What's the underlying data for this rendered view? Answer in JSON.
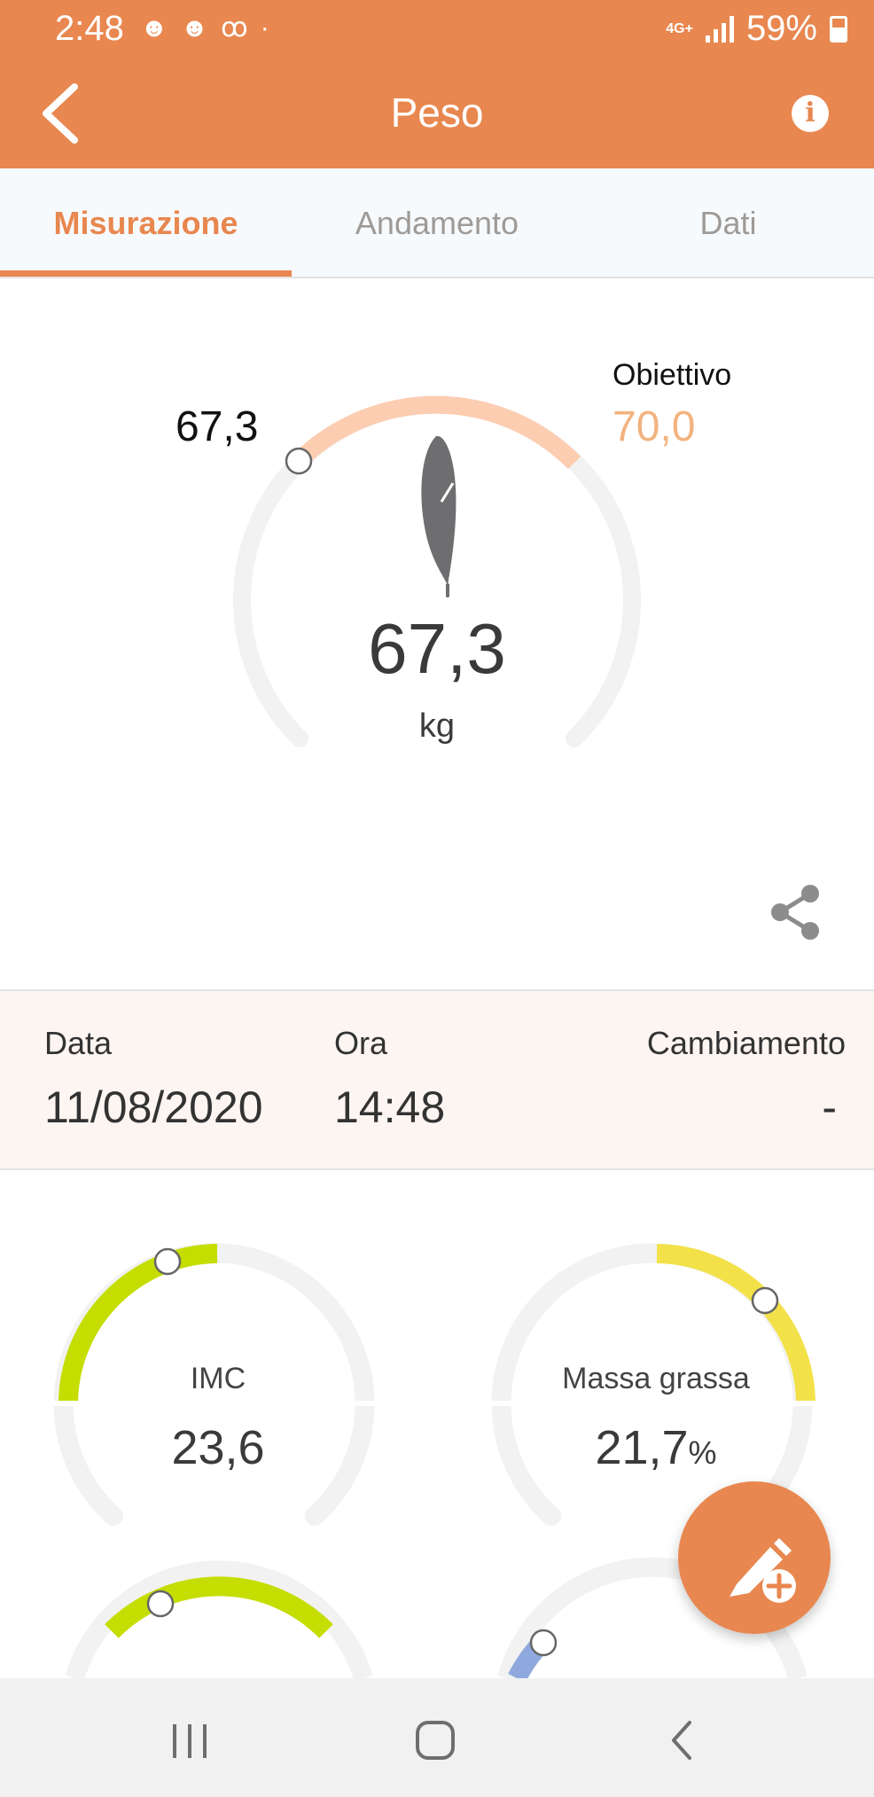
{
  "status_bar": {
    "time": "2:48",
    "notification_icons": [
      "smiley-icon",
      "smiley-icon",
      "voicemail-icon",
      "dot-icon"
    ],
    "network": "4G+",
    "battery": "59%"
  },
  "header": {
    "title": "Peso",
    "back_icon": "chevron-left-icon",
    "info_icon": "info-icon"
  },
  "tabs": [
    {
      "label": "Misurazione",
      "active": true
    },
    {
      "label": "Andamento",
      "active": false
    },
    {
      "label": "Dati",
      "active": false
    }
  ],
  "gauge": {
    "start_value": "67,3",
    "goal_label": "Obiettivo",
    "goal_value": "70,0",
    "current_value": "67,3",
    "unit": "kg",
    "icon": "feather-icon",
    "colors": {
      "track": "#F2F2F2",
      "progress": "#FCCDB1",
      "accent": "#E8874F"
    }
  },
  "measurement": {
    "date_label": "Data",
    "date": "11/08/2020",
    "time_label": "Ora",
    "time": "14:48",
    "change_label": "Cambiamento",
    "change": "-"
  },
  "metrics": [
    {
      "label": "IMC",
      "value": "23,6",
      "unit": "",
      "color": "#C5DD00"
    },
    {
      "label": "Massa grassa",
      "value": "21,7",
      "unit": "%",
      "color": "#F3E14A"
    }
  ],
  "fab": {
    "icon": "edit-add-icon"
  },
  "system_nav": {
    "icons": [
      "recent-apps-icon",
      "home-icon",
      "back-icon"
    ]
  }
}
